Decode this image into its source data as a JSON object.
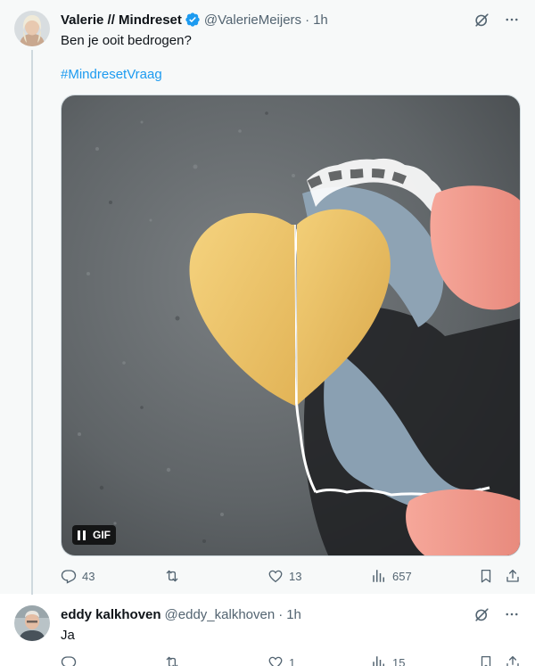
{
  "main_tweet": {
    "display_name": "Valerie // Mindreset",
    "handle": "@ValerieMeijers",
    "separator": "·",
    "time": "1h",
    "text": "Ben je ooit bedrogen?",
    "hashtag": "#MindresetVraag",
    "media": {
      "badge": "GIF",
      "state": "paused"
    },
    "stats": {
      "replies": "43",
      "retweets": "",
      "likes": "13",
      "views": "657"
    }
  },
  "reply_tweet": {
    "display_name": "eddy kalkhoven",
    "handle": "@eddy_kalkhoven",
    "separator": "·",
    "time": "1h",
    "text": "Ja",
    "stats": {
      "replies": "",
      "retweets": "",
      "likes": "1",
      "views": "15"
    }
  },
  "icons": {
    "verified": "verified-badge-icon",
    "grok": "grok-icon",
    "more": "more-icon",
    "reply": "reply-icon",
    "retweet": "retweet-icon",
    "like": "heart-icon",
    "views": "views-chart-icon",
    "bookmark": "bookmark-icon",
    "share": "share-icon"
  },
  "colors": {
    "accent": "#1d9bf0",
    "text": "#0f1419",
    "muted": "#536471",
    "thread_line": "#cfd9de",
    "highlight_bg": "#f7f9f9"
  }
}
